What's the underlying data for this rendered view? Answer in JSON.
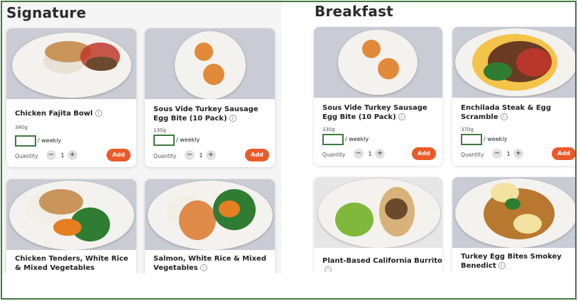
{
  "sections": {
    "left": {
      "title": "Signature"
    },
    "right": {
      "title": "Breakfast"
    }
  },
  "meals": [
    {
      "name": "Chicken Fajita Bowl",
      "weight": "340g",
      "weekly": "/ weekly",
      "quantity_label": "Quantity",
      "qty": "1",
      "add": "Add"
    },
    {
      "name": "Sous Vide Turkey Sausage Egg Bite (10 Pack)",
      "weight": "130g",
      "weekly": "/ weekly",
      "quantity_label": "Quantity",
      "qty": "1",
      "add": "Add"
    },
    {
      "name": "Chicken Tenders, White Rice & Mixed Vegetables"
    },
    {
      "name": "Salmon, White Rice & Mixed Vegetables"
    },
    {
      "name": "Sous Vide Turkey Sausage Egg Bite (10 Pack)",
      "weight": "130g",
      "weekly": "/ weekly",
      "quantity_label": "Quantity",
      "qty": "1",
      "add": "Add"
    },
    {
      "name": "Enchilada Steak & Egg Scramble",
      "weight": "370g",
      "weekly": "/ weekly",
      "quantity_label": "Quantity",
      "qty": "1",
      "add": "Add"
    },
    {
      "name": "Plant-Based California Burrito"
    },
    {
      "name": "Turkey Egg Bites Smokey Benedict"
    }
  ],
  "icons": {
    "info": "info-icon",
    "minus": "minus-icon",
    "plus": "plus-icon"
  },
  "glyphs": {
    "info": "i",
    "minus": "−",
    "plus": "+"
  },
  "colors": {
    "accent": "#ea5a2a",
    "frame": "#3f7a3f"
  }
}
